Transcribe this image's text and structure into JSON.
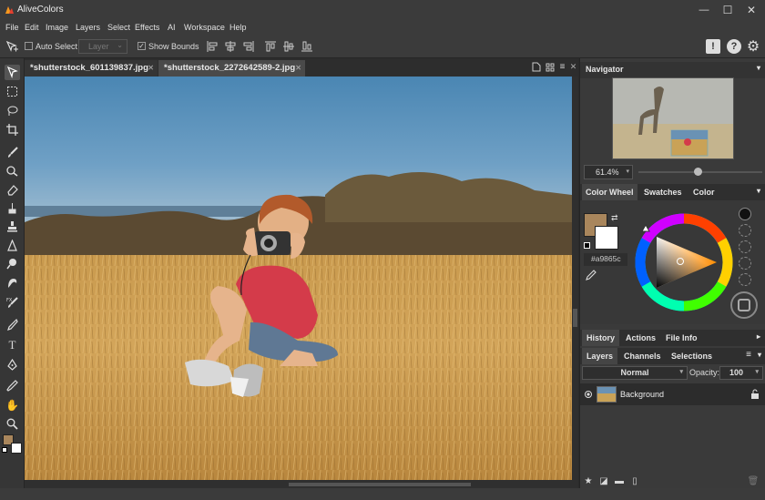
{
  "app": {
    "title": "AliveColors"
  },
  "window_controls": {
    "minimize": "—",
    "maximize": "☐",
    "close": "✕"
  },
  "menu": [
    "File",
    "Edit",
    "Image",
    "Layers",
    "Select",
    "Effects",
    "AI",
    "Workspace",
    "Help"
  ],
  "options": {
    "auto_select_label": "Auto Select",
    "auto_select_checked": false,
    "layer_select_value": "Layer",
    "show_bounds_label": "Show Bounds",
    "show_bounds_checked": true
  },
  "tabs": [
    {
      "label": "*shutterstock_601139837.jpg",
      "active": false
    },
    {
      "label": "*shutterstock_2272642589-2.jpg",
      "active": true
    }
  ],
  "navigator": {
    "title": "Navigator",
    "zoom": "61.4%",
    "zoom_fraction": 0.48
  },
  "color_panel": {
    "tabs": [
      "Color Wheel",
      "Swatches",
      "Color"
    ],
    "active_tab": "Color Wheel",
    "hex": "#a9865c",
    "foreground": "#a9865c",
    "background": "#ffffff"
  },
  "history_panel": {
    "tabs": [
      "History",
      "Actions",
      "File Info"
    ],
    "active_tab": "History"
  },
  "layers_panel": {
    "tabs": [
      "Layers",
      "Channels",
      "Selections"
    ],
    "active_tab": "Layers",
    "blend_mode": "Normal",
    "opacity_label": "Opacity:",
    "opacity_value": "100",
    "layers": [
      {
        "name": "Background",
        "visible": true,
        "locked": true
      }
    ]
  },
  "colors": {
    "accent": "#3d8ee8",
    "chrome": "#3b3b3b",
    "panel": "#3a3a3a"
  }
}
